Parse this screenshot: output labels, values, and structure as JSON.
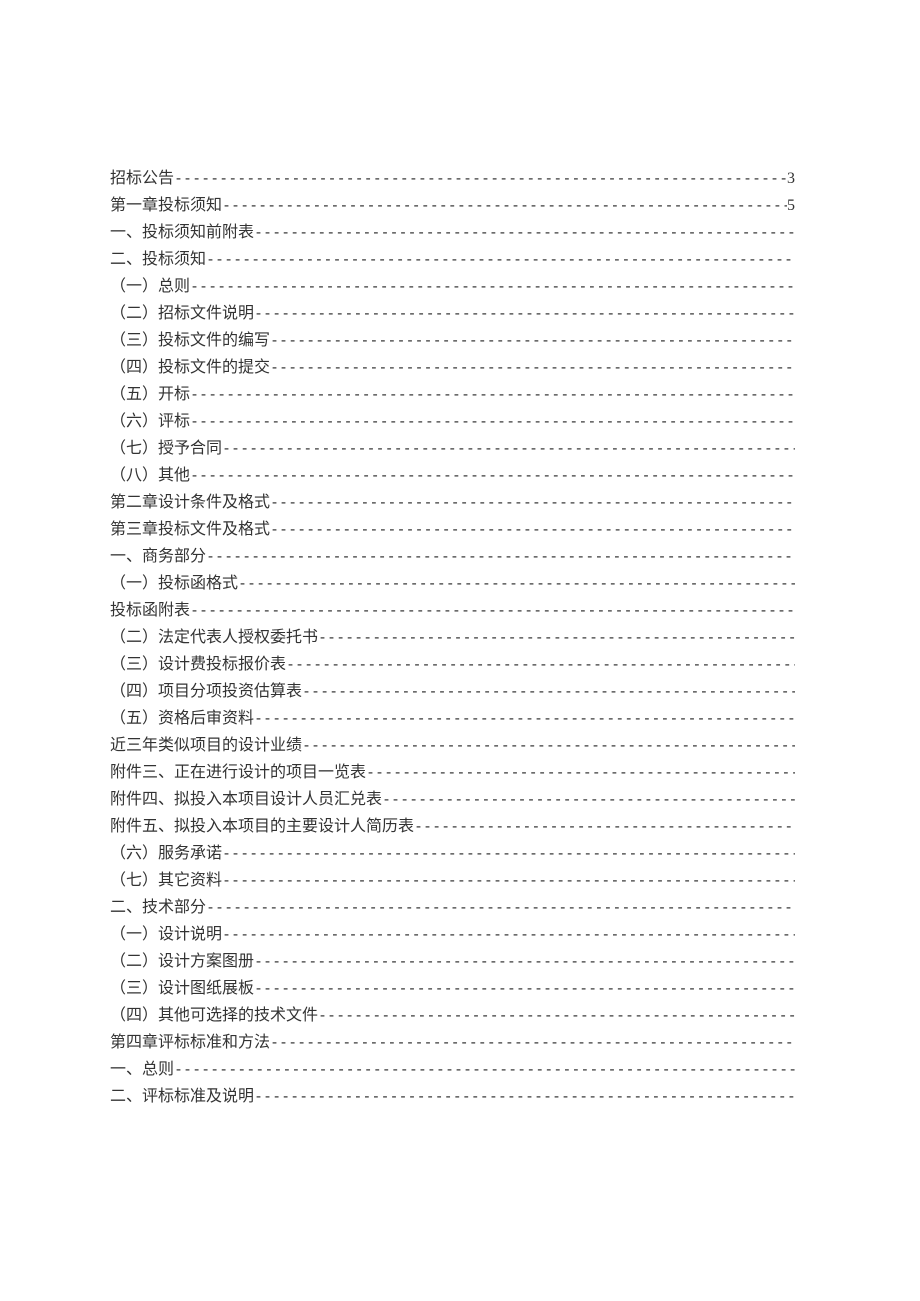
{
  "toc": [
    {
      "label": "招标公告",
      "page": "3"
    },
    {
      "label": "第一章投标须知",
      "page": "5"
    },
    {
      "label": "一、投标须知前附表",
      "page": ""
    },
    {
      "label": "二、投标须知",
      "page": ""
    },
    {
      "label": "（一）总则",
      "page": ""
    },
    {
      "label": "（二）招标文件说明",
      "page": ""
    },
    {
      "label": "（三）投标文件的编写",
      "page": ""
    },
    {
      "label": "（四）投标文件的提交",
      "page": ""
    },
    {
      "label": "（五）开标",
      "page": ""
    },
    {
      "label": "（六）评标",
      "page": ""
    },
    {
      "label": "（七）授予合同",
      "page": ""
    },
    {
      "label": "（八）其他",
      "page": ""
    },
    {
      "label": "第二章设计条件及格式",
      "page": ""
    },
    {
      "label": "第三章投标文件及格式",
      "page": ""
    },
    {
      "label": "一、商务部分",
      "page": ""
    },
    {
      "label": "（一）投标函格式",
      "page": ""
    },
    {
      "label": "投标函附表",
      "page": ""
    },
    {
      "label": "（二）法定代表人授权委托书",
      "page": ""
    },
    {
      "label": "（三）设计费投标报价表",
      "page": ""
    },
    {
      "label": "（四）项目分项投资估算表",
      "page": ""
    },
    {
      "label": "（五）资格后审资料",
      "page": ""
    },
    {
      "label": "近三年类似项目的设计业绩",
      "page": ""
    },
    {
      "label": "附件三、正在进行设计的项目一览表",
      "page": ""
    },
    {
      "label": "附件四、拟投入本项目设计人员汇兑表",
      "page": ""
    },
    {
      "label": "附件五、拟投入本项目的主要设计人简历表",
      "page": ""
    },
    {
      "label": "（六）服务承诺",
      "page": ""
    },
    {
      "label": "（七）其它资料",
      "page": ""
    },
    {
      "label": "二、技术部分",
      "page": ""
    },
    {
      "label": "（一）设计说明",
      "page": ""
    },
    {
      "label": "（二）设计方案图册",
      "page": ""
    },
    {
      "label": "（三）设计图纸展板",
      "page": ""
    },
    {
      "label": "（四）其他可选择的技术文件",
      "page": ""
    },
    {
      "label": "第四章评标标准和方法",
      "page": ""
    },
    {
      "label": "一、总则",
      "page": ""
    },
    {
      "label": "二、评标标准及说明",
      "page": ""
    }
  ]
}
